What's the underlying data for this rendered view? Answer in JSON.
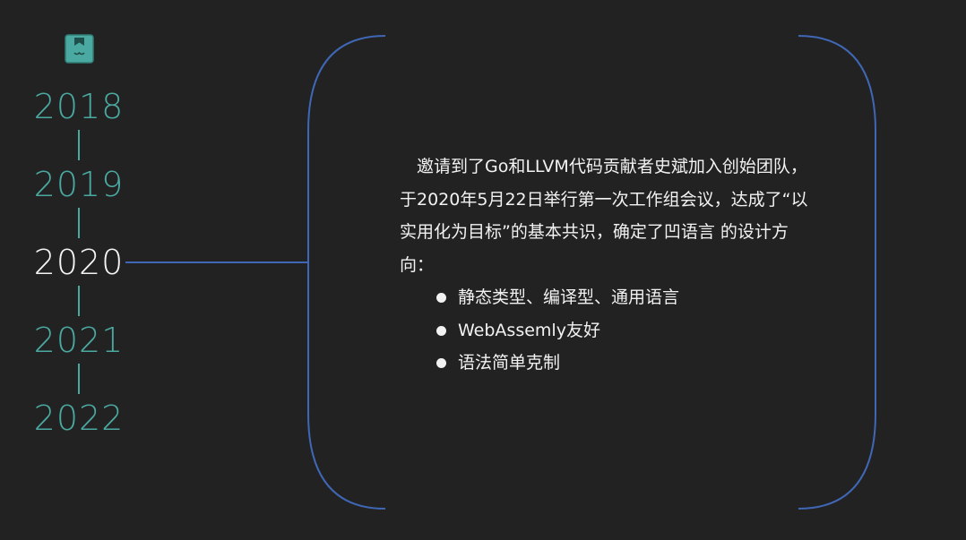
{
  "colors": {
    "background": "#222222",
    "accent_teal": "#4aa9a0",
    "accent_blue": "#3f67b5",
    "text": "#f2f2f2"
  },
  "logo": {
    "icon": "bookmark-box-icon"
  },
  "timeline": {
    "years": [
      {
        "label": "2018",
        "active": false
      },
      {
        "label": "2019",
        "active": false
      },
      {
        "label": "2020",
        "active": true
      },
      {
        "label": "2021",
        "active": false
      },
      {
        "label": "2022",
        "active": false
      }
    ]
  },
  "content": {
    "paragraph": "　邀请到了Go和LLVM代码贡献者史斌加入创始团队，于2020年5月22日举行第一次工作组会议，达成了“以实用化为目标”的基本共识，确定了凹语言 的设计方向：",
    "bullets": [
      "静态类型、编译型、通用语言",
      "WebAssemly友好",
      "语法简单克制"
    ]
  }
}
